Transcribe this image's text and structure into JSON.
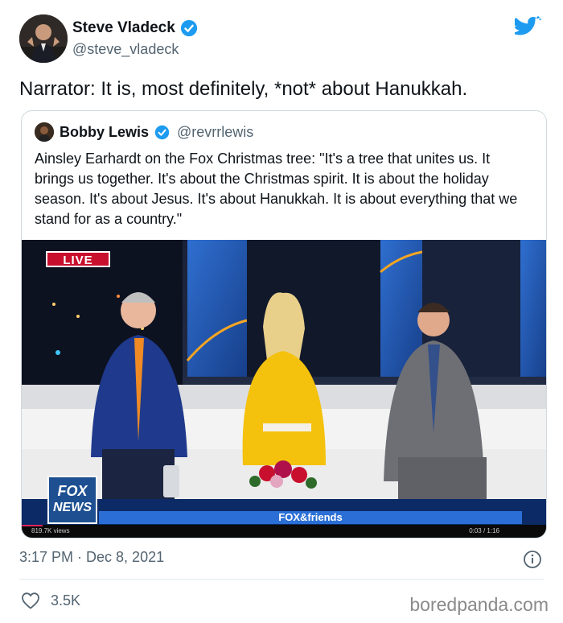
{
  "tweet": {
    "author": {
      "name": "Steve Vladeck",
      "handle": "@steve_vladeck"
    },
    "text": "Narrator: It is, most definitely, *not* about Hanukkah.",
    "timestamp": "3:17 PM · Dec 8, 2021",
    "likes": "3.5K"
  },
  "quote": {
    "author": {
      "name": "Bobby Lewis",
      "handle": "@revrrlewis"
    },
    "text": "Ainsley Earhardt on the Fox Christmas tree: \"It's a tree that unites us. It brings us together. It's about the Christmas spirit. It is about the holiday season. It's about Jesus. It's about Hanukkah. It is about everything that we stand for as a country.\""
  },
  "video": {
    "live_label": "LIVE",
    "logo_line1": "FOX",
    "logo_line2": "NEWS",
    "banner": "FOX&friends",
    "views": "819.7K views",
    "time": "0:03 / 1:16",
    "progress": 0.04
  },
  "watermark": "boredpanda.com",
  "colors": {
    "twitter_blue": "#1d9bf0",
    "text": "#0f1419",
    "secondary": "#536471",
    "border": "#cfd9de",
    "live_red": "#c8102e"
  },
  "icons": [
    "verified-badge-icon",
    "twitter-bird-icon",
    "info-icon",
    "heart-icon"
  ]
}
